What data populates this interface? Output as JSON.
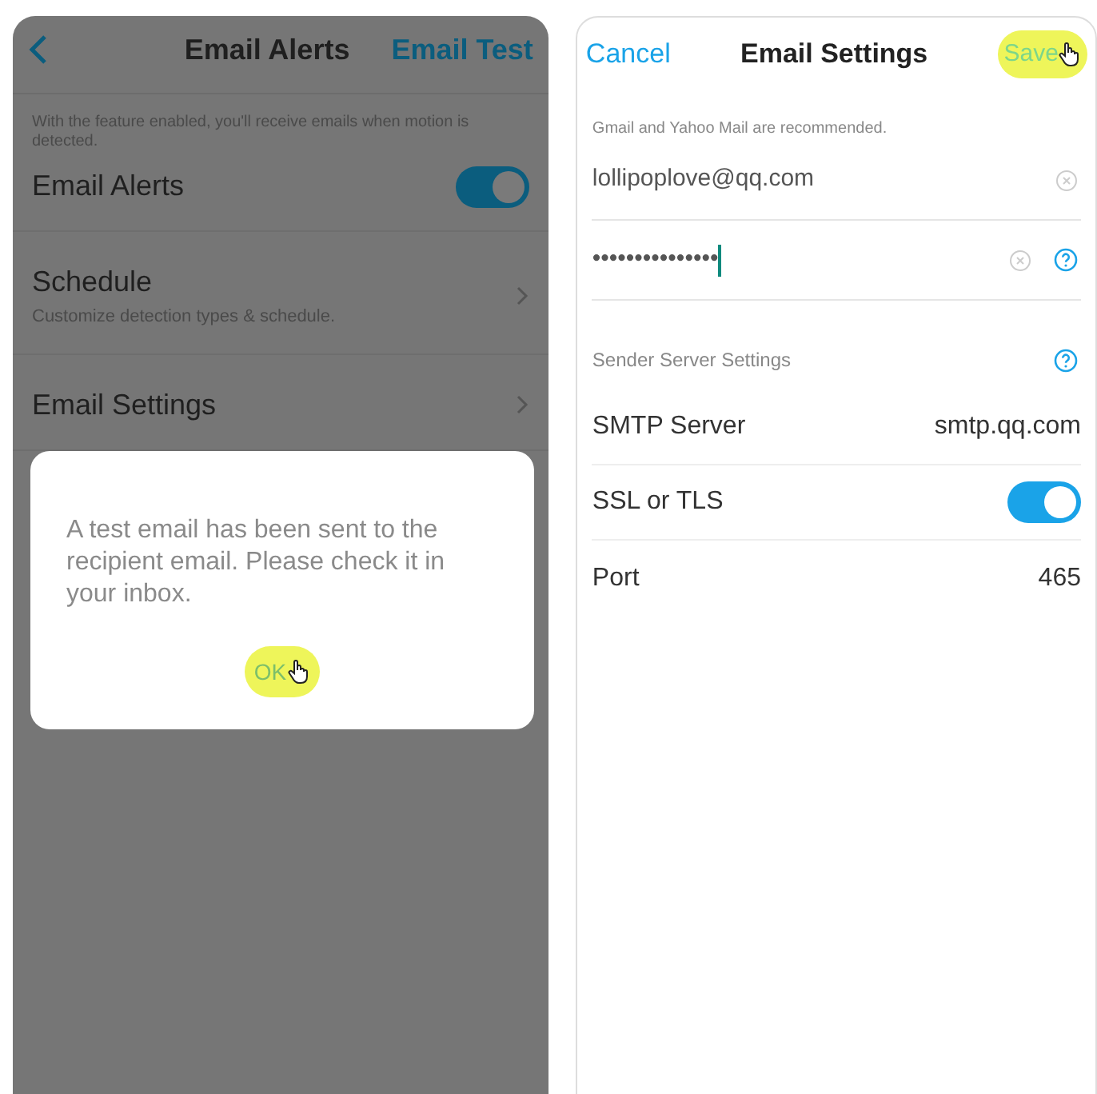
{
  "alerts_screen": {
    "title": "Email Alerts",
    "action": "Email Test",
    "description": "With the feature enabled, you'll receive emails when motion is detected.",
    "rows": [
      {
        "kind": "toggle",
        "label": "Email Alerts",
        "on": true
      },
      {
        "kind": "link",
        "label": "Schedule",
        "sublabel": "Customize detection types & schedule."
      },
      {
        "kind": "link",
        "label": "Email Settings"
      }
    ],
    "dialog": {
      "message": "A test email has been sent to the recipient email. Please check it in your inbox.",
      "button": "OK"
    }
  },
  "settings_screen": {
    "cancel": "Cancel",
    "title": "Email Settings",
    "save": "Save",
    "hint": "Gmail and Yahoo Mail are recommended.",
    "fields": [
      {
        "value": "lollipoplove@qq.com",
        "help": false,
        "focused": false
      },
      {
        "value": "•••••••••••••••",
        "help": true,
        "focused": true
      }
    ],
    "section": "Sender Server Settings",
    "rows": [
      {
        "kind": "value",
        "label": "SMTP Server",
        "value": "smtp.qq.com"
      },
      {
        "kind": "toggle",
        "label": "SSL or TLS",
        "on": true
      },
      {
        "kind": "value",
        "label": "Port",
        "value": "465"
      }
    ]
  }
}
